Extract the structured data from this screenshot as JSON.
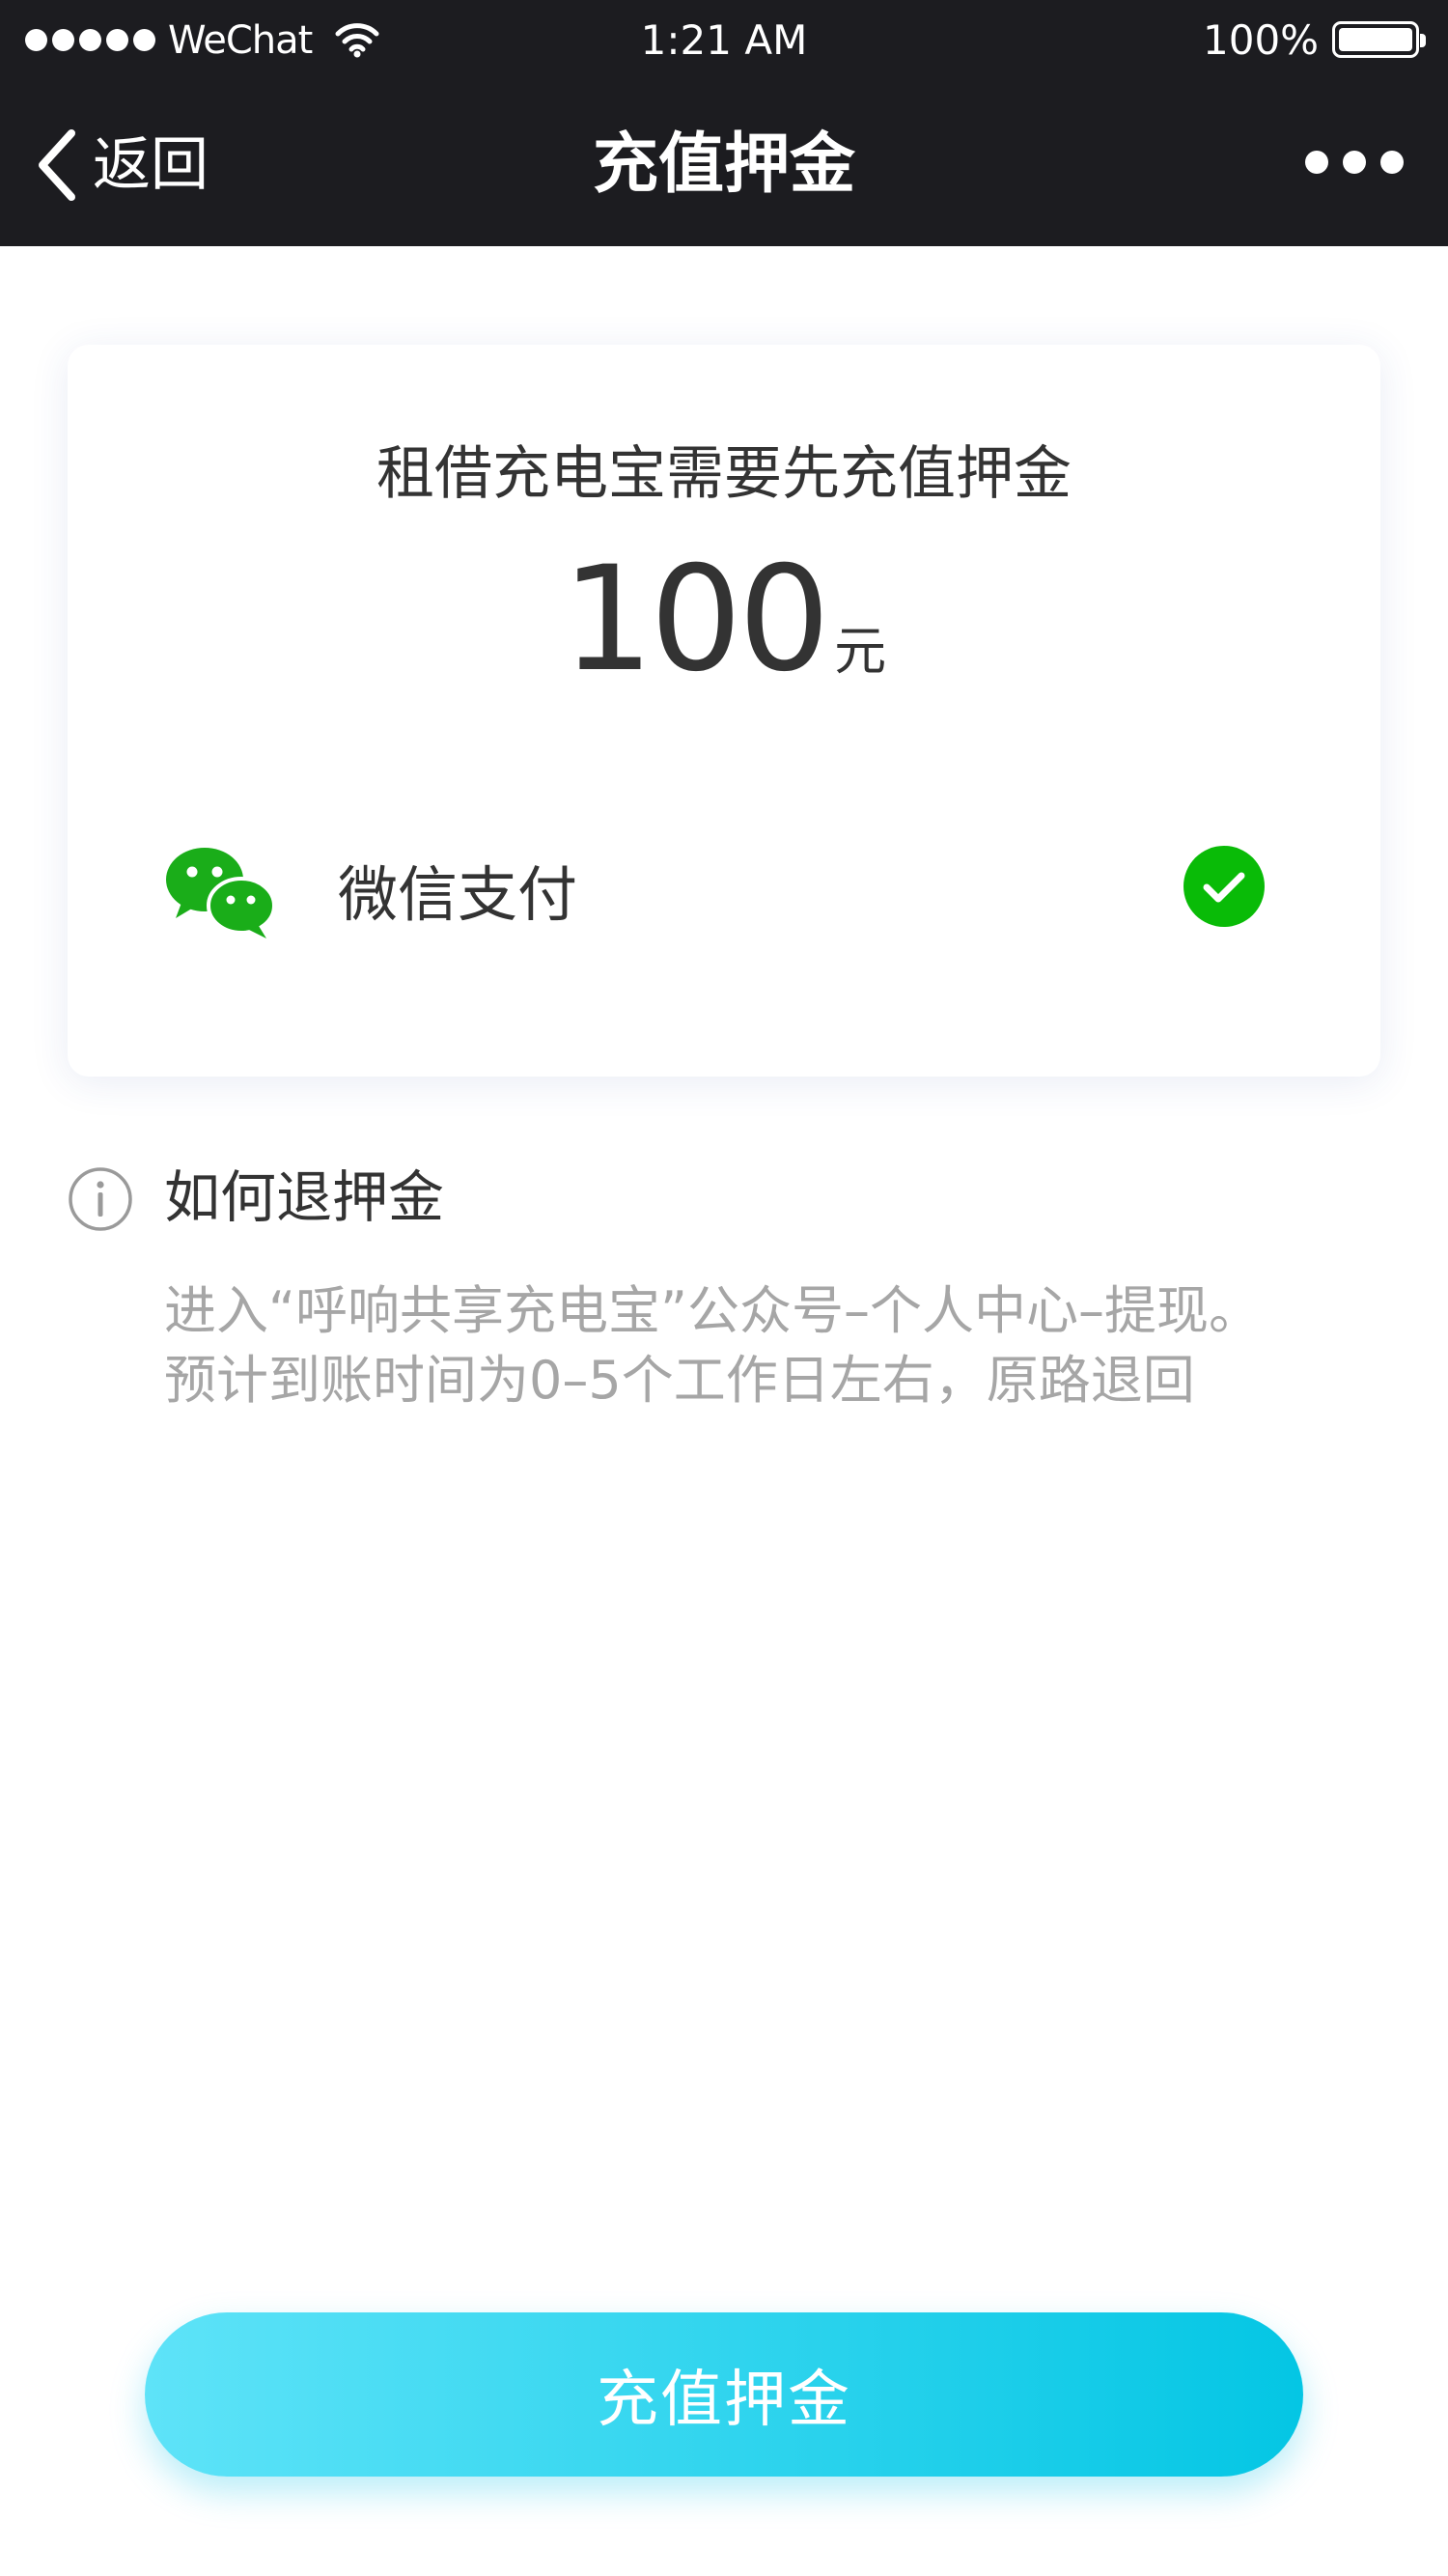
{
  "status_bar": {
    "carrier": "WeChat",
    "time": "1:21 AM",
    "battery": "100%",
    "signal_bars": 5,
    "battery_level": 1.0,
    "icons": [
      "signal-dots-icon",
      "wifi-icon",
      "battery-icon"
    ]
  },
  "nav": {
    "back_label": "返回",
    "title": "充值押金",
    "icons": [
      "chevron-left-icon",
      "more-dots-icon"
    ]
  },
  "deposit_card": {
    "title": "租借充电宝需要先充值押金",
    "amount": "100",
    "unit": "元",
    "payment_method": {
      "label": "微信支付",
      "icon": "wechat-icon",
      "selected": true,
      "selected_icon": "check-circle-icon",
      "brand_color": "#1aad19"
    }
  },
  "refund_info": {
    "icon": "info-icon",
    "title": "如何退押金",
    "lines": [
      "进入“呼响共享充电宝”公众号–个人中心–提现。",
      "预计到账时间为0–5个工作日左右，原路退回"
    ]
  },
  "action_button": {
    "label": "充值押金",
    "gradient": [
      "#5ee3f8",
      "#04c6e4"
    ]
  },
  "colors": {
    "header_bg": "#1c1c20",
    "text_primary": "#333333",
    "text_secondary": "#a6a6a6",
    "accent": "#09bb07"
  }
}
